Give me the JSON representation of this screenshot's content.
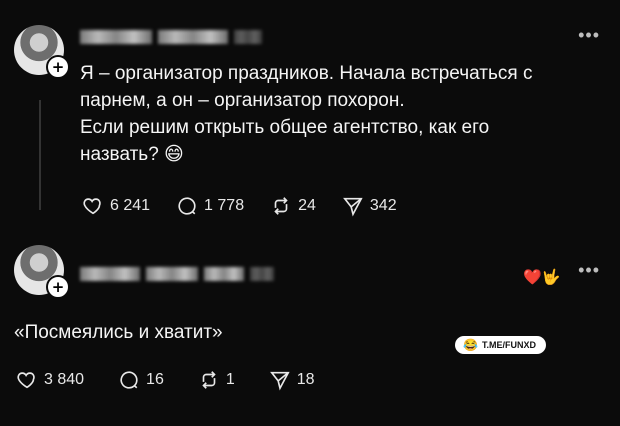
{
  "post1": {
    "text_lines": [
      "Я – организатор праздников. Начала встречаться с",
      "парнем, а он – организатор похорон.",
      "Если решим открыть общее агентство, как его",
      "назвать? 😄"
    ],
    "likes": "6 241",
    "replies": "1 778",
    "reposts": "24",
    "shares": "342"
  },
  "post2": {
    "text": "«Посмеялись и хватит»",
    "reaction": "❤️🤟",
    "sticker": {
      "emoji": "😂",
      "label": "T.ME/FUNXD"
    },
    "likes": "3 840",
    "replies": "16",
    "reposts": "1",
    "shares": "18"
  },
  "more_icon": "•••",
  "add_icon": "+"
}
